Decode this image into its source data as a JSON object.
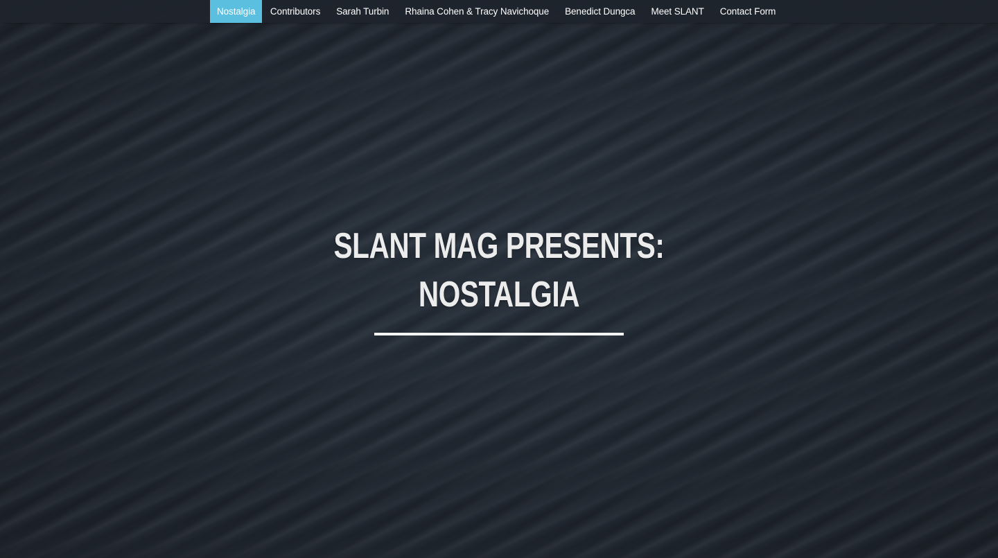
{
  "nav": {
    "items": [
      {
        "label": "Nostalgia",
        "active": true
      },
      {
        "label": "Contributors",
        "active": false
      },
      {
        "label": "Sarah Turbin",
        "active": false
      },
      {
        "label": "Rhaina Cohen & Tracy Navichoque",
        "active": false
      },
      {
        "label": "Benedict Dungca",
        "active": false
      },
      {
        "label": "Meet SLANT",
        "active": false
      },
      {
        "label": "Contact Form",
        "active": false
      }
    ]
  },
  "hero": {
    "title_line1": "SLANT MAG PRESENTS:",
    "title_line2": "NOSTALGIA"
  },
  "colors": {
    "nav_active": "#5bbfdf",
    "background": "#1e252e",
    "title_text": "#ececec"
  }
}
